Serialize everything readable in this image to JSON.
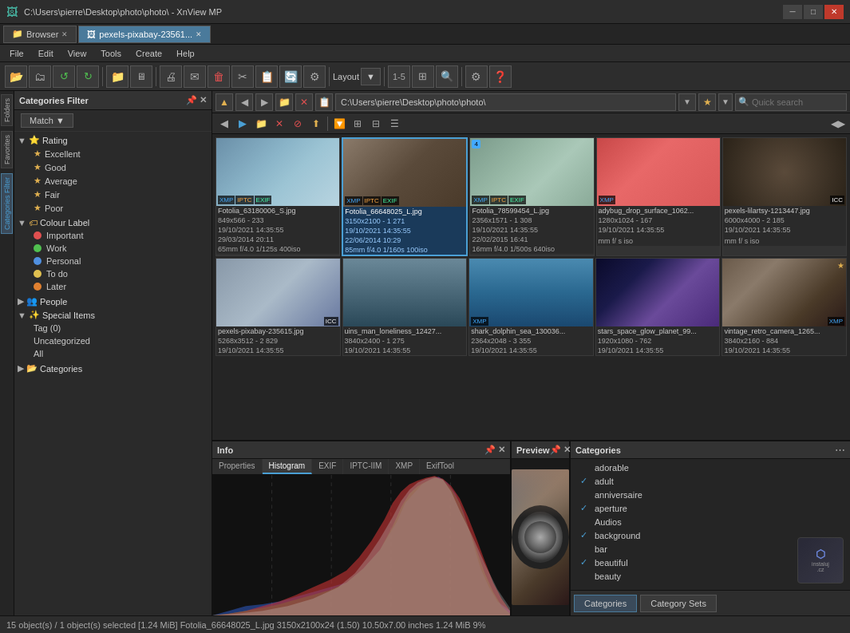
{
  "titlebar": {
    "path": "C:\\Users\\pierre\\Desktop\\photo\\photo\\ - XnView MP",
    "icon": "🖼",
    "minimize": "─",
    "maximize": "□",
    "close": "✕"
  },
  "tabs": [
    {
      "label": "Browser",
      "active": false,
      "closable": true
    },
    {
      "label": "pexels-pixabay-23561...",
      "active": true,
      "closable": true
    }
  ],
  "menubar": {
    "items": [
      "File",
      "Edit",
      "View",
      "Tools",
      "Create",
      "Help"
    ]
  },
  "categories_filter": {
    "title": "Categories Filter",
    "match_label": "Match",
    "tree": {
      "rating": {
        "label": "Rating",
        "items": [
          "Excellent",
          "Good",
          "Average",
          "Fair",
          "Poor"
        ]
      },
      "colour_label": {
        "label": "Colour Label",
        "items": [
          {
            "name": "Important",
            "color": "#e05050"
          },
          {
            "name": "Work",
            "color": "#50c050"
          },
          {
            "name": "Personal",
            "color": "#5090e0"
          },
          {
            "name": "To do",
            "color": "#e0c050"
          },
          {
            "name": "Later",
            "color": "#e08030"
          }
        ]
      },
      "people": {
        "label": "People"
      },
      "special_items": {
        "label": "Special Items",
        "items": [
          "Tag (0)",
          "Uncategorized",
          "All"
        ]
      },
      "categories": {
        "label": "Categories"
      }
    }
  },
  "addressbar": {
    "path": "C:\\Users\\pierre\\Desktop\\photo\\photo\\",
    "search_placeholder": "Quick search"
  },
  "thumbnails": {
    "row1": [
      {
        "name": "Fotolia_63180006_S.jpg",
        "meta1": "849x566 - 233",
        "meta2": "19/10/2021 14:35:55",
        "meta3": "29/03/2014 20:11",
        "meta4": "65mm f/4.0 1/125s 400iso",
        "badges": [
          "XMP",
          "IPTC",
          "EXIF"
        ],
        "img_class": "img-people"
      },
      {
        "name": "Fotolia_66648025_L.jpg",
        "meta1": "3150x2100 - 1 271",
        "meta2": "19/10/2021 14:35:55",
        "meta3": "22/06/2014 10:29",
        "meta4": "85mm f/4.0 1/160s 100iso",
        "badges": [
          "XMP",
          "IPTC",
          "EXIF"
        ],
        "img_class": "img-camera",
        "selected": true
      },
      {
        "name": "Fotolia_78599454_L.jpg",
        "meta1": "2356x1571 - 1 308",
        "meta2": "19/10/2021 14:35:55",
        "meta3": "22/02/2015 16:41",
        "meta4": "16mm f/4.0 1/500s 640iso",
        "badges": [
          "XMP",
          "IPTC",
          "EXIF"
        ],
        "img_class": "img-selfie"
      },
      {
        "name": "adybug_drop_surface_1062...",
        "meta1": "1280x1024 - 167",
        "meta2": "19/10/2021 14:35:55",
        "meta3": "",
        "meta4": "mm f/ s iso",
        "badges": [
          "XMP"
        ],
        "img_class": "img-ladybug"
      },
      {
        "name": "pexels-lilartsy-1213447.jpg",
        "meta1": "6000x4000 - 2 185",
        "meta2": "19/10/2021 14:35:55",
        "meta3": "",
        "meta4": "mm f/ s iso",
        "badges": [
          "ICC"
        ],
        "img_class": "img-insect"
      }
    ],
    "row2": [
      {
        "name": "pexels-pixabay-235615.jpg",
        "meta1": "5268x3512 - 2 829",
        "meta2": "19/10/2021 14:35:55",
        "meta3": "",
        "meta4": "",
        "badges": [
          "ICC"
        ],
        "img_class": "img-ball"
      },
      {
        "name": "uins_man_loneliness_12427...",
        "meta1": "3840x2400 - 1 275",
        "meta2": "19/10/2021 14:35:55",
        "meta3": "",
        "meta4": "",
        "badges": [],
        "img_class": "img-aqueduct"
      },
      {
        "name": "shark_dolphin_sea_130036...",
        "meta1": "2364x2048 - 3 355",
        "meta2": "19/10/2021 14:35:55",
        "meta3": "",
        "meta4": "",
        "badges": [
          "XMP"
        ],
        "img_class": "img-dolphin"
      },
      {
        "name": "stars_space_glow_planet_99...",
        "meta1": "1920x1080 - 762",
        "meta2": "19/10/2021 14:35:55",
        "meta3": "",
        "meta4": "",
        "badges": [],
        "img_class": "img-space"
      },
      {
        "name": "vintage_retro_camera_1265...",
        "meta1": "3840x2160 - 884",
        "meta2": "19/10/2021 14:35:55",
        "meta3": "",
        "meta4": "",
        "badges": [
          "XMP"
        ],
        "img_class": "img-camera2"
      }
    ]
  },
  "info_panel": {
    "title": "Info",
    "tabs": [
      "Properties",
      "Histogram",
      "EXIF",
      "IPTC-IIM",
      "XMP",
      "ExifTool"
    ]
  },
  "preview": {
    "title": "Preview"
  },
  "categories_panel": {
    "title": "Categories",
    "items": [
      {
        "label": "adorable",
        "checked": false
      },
      {
        "label": "adult",
        "checked": true
      },
      {
        "label": "anniversaire",
        "checked": false
      },
      {
        "label": "aperture",
        "checked": true
      },
      {
        "label": "Audios",
        "checked": false
      },
      {
        "label": "background",
        "checked": true
      },
      {
        "label": "bar",
        "checked": false
      },
      {
        "label": "beautiful",
        "checked": true
      },
      {
        "label": "beauty",
        "checked": false
      }
    ],
    "footer_btn1": "Categories",
    "footer_btn2": "Category Sets"
  },
  "statusbar": {
    "text": "15 object(s) / 1 object(s) selected [1.24 MiB]  Fotolia_66648025_L.jpg  3150x2100x24 (1.50)  10.50x7.00 inches  1.24 MiB  9%"
  },
  "histogram": {
    "colors": {
      "red": "#e05050",
      "green": "#50c050",
      "blue": "#5080e0",
      "white": "#cccccc"
    }
  }
}
